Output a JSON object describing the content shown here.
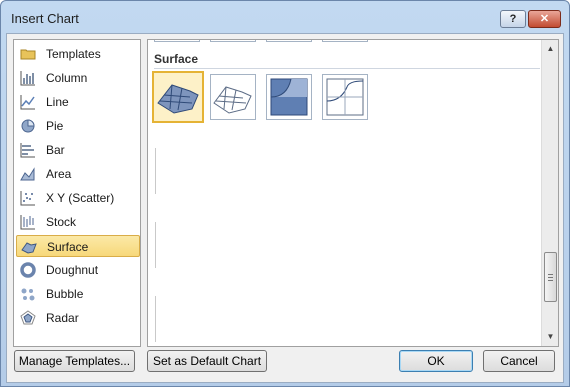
{
  "window": {
    "title": "Insert Chart"
  },
  "titlebar": {
    "help_label": "?",
    "close_label": "✕"
  },
  "chart_types": [
    {
      "label": "Templates",
      "icon": "templates-folder-icon"
    },
    {
      "label": "Column",
      "icon": "column-chart-icon"
    },
    {
      "label": "Line",
      "icon": "line-chart-icon"
    },
    {
      "label": "Pie",
      "icon": "pie-chart-icon"
    },
    {
      "label": "Bar",
      "icon": "bar-chart-icon"
    },
    {
      "label": "Area",
      "icon": "area-chart-icon"
    },
    {
      "label": "X Y (Scatter)",
      "icon": "scatter-chart-icon"
    },
    {
      "label": "Stock",
      "icon": "stock-chart-icon"
    },
    {
      "label": "Surface",
      "icon": "surface-chart-icon",
      "selected": true
    },
    {
      "label": "Doughnut",
      "icon": "doughnut-chart-icon"
    },
    {
      "label": "Bubble",
      "icon": "bubble-chart-icon"
    },
    {
      "label": "Radar",
      "icon": "radar-chart-icon"
    }
  ],
  "gallery": {
    "section_title": "Surface",
    "thumbnails": [
      {
        "icon": "3d-surface-icon",
        "selected": true
      },
      {
        "icon": "wireframe-3d-surface-icon"
      },
      {
        "icon": "contour-icon"
      },
      {
        "icon": "wireframe-contour-icon"
      }
    ]
  },
  "buttons": {
    "manage_templates": "Manage Templates...",
    "set_default": "Set as Default Chart",
    "ok": "OK",
    "cancel": "Cancel"
  },
  "colors": {
    "selection_fill": "#f7d87a",
    "selection_border": "#d9ad48",
    "accent": "#3c7fb1"
  }
}
